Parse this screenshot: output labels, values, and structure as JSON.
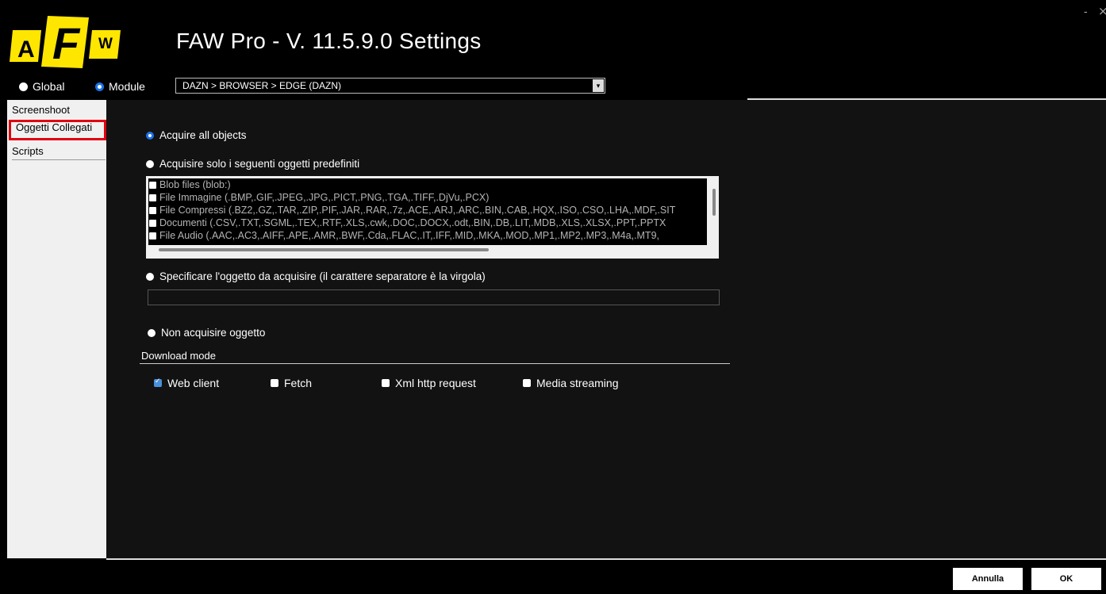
{
  "window": {
    "minimize": "-",
    "close": "×"
  },
  "logo": {
    "letters": [
      "A",
      "F",
      "W"
    ]
  },
  "title": "FAW Pro - V. 11.5.9.0  Settings",
  "scope": {
    "global_label": "Global",
    "module_label": "Module",
    "selected": "Module"
  },
  "module_select": {
    "value": "DAZN > BROWSER > EDGE (DAZN)"
  },
  "sidebar": {
    "items": [
      {
        "label": "Screenshoot",
        "selected": false
      },
      {
        "label": "Oggetti Collegati",
        "selected": true
      },
      {
        "label": "Scripts",
        "selected": false
      }
    ]
  },
  "options": {
    "acquire_all": "Acquire all objects",
    "acquire_predefined": "Acquisire solo i seguenti oggetti predefiniti",
    "specify": "Specificare l'oggetto da acquisire (il carattere separatore è la virgola)",
    "none": "Non acquisire oggetto",
    "selected": "acquire_all"
  },
  "object_list": [
    "Blob files (blob:)",
    "File Immagine (.BMP,.GIF,.JPEG,.JPG,.PICT,.PNG,.TGA,.TIFF,.DjVu,.PCX)",
    "File Compressi (.BZ2,.GZ,.TAR,.ZIP,.PIF,.JAR,.RAR,.7z,.ACE,.ARJ,.ARC,.BIN,.CAB,.HQX,.ISO,.CSO,.LHA,.MDF,.SIT",
    "Documenti (.CSV,.TXT,.SGML,.TEX,.RTF,.XLS,.cwk,.DOC,.DOCX,.odt,.BIN,.DB,.LIT,.MDB,.XLS,.XLSX,.PPT,.PPTX",
    "File Audio (.AAC,.AC3,.AIFF,.APE,.AMR,.BWF,.Cda,.FLAC,.IT,.IFF,.MID,.MKA,.MOD,.MP1,.MP2,.MP3,.M4a,.MT9,"
  ],
  "specify_input": {
    "value": ""
  },
  "download_mode": {
    "label": "Download mode",
    "options": [
      {
        "label": "Web client",
        "checked": true
      },
      {
        "label": "Fetch",
        "checked": false
      },
      {
        "label": "Xml http request",
        "checked": false
      },
      {
        "label": "Media streaming",
        "checked": false
      }
    ]
  },
  "buttons": {
    "cancel": "Annulla",
    "ok": "OK"
  },
  "colors": {
    "accent": "#1a73e8",
    "highlight_border": "#e00010",
    "logo_yellow": "#ffe600"
  }
}
